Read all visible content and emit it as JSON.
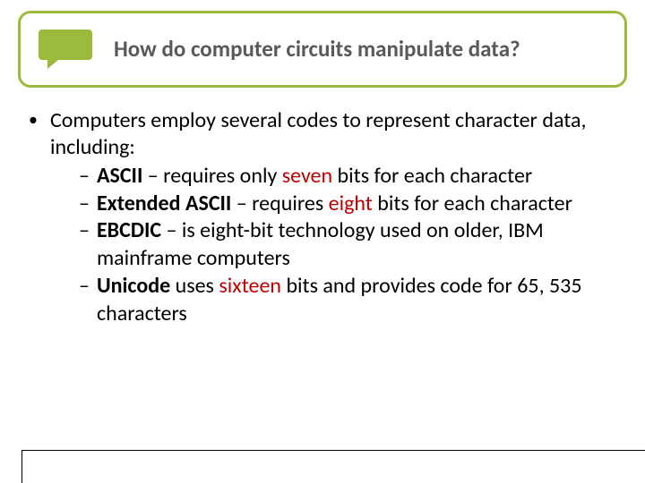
{
  "title": "How do computer circuits manipulate data?",
  "intro": "Computers employ several codes to represent character data, including:",
  "items": [
    {
      "name": "ASCII",
      "pre": " – requires only ",
      "hl": "seven",
      "post": " bits for each character"
    },
    {
      "name": "Extended ASCII",
      "pre": " – requires ",
      "hl": "eight",
      "post": " bits for each character"
    },
    {
      "name": "EBCDIC",
      "pre": " – is eight-bit technology used on older, IBM mainframe computers",
      "hl": "",
      "post": ""
    },
    {
      "name": "Unicode",
      "pre": " uses ",
      "hl": "sixteen",
      "post": " bits and provides code for 65, 535 characters"
    }
  ],
  "icon": "speech-bubble-icon",
  "colors": {
    "accent": "#9bbb3c",
    "highlight": "#c00000",
    "title": "#595959"
  }
}
